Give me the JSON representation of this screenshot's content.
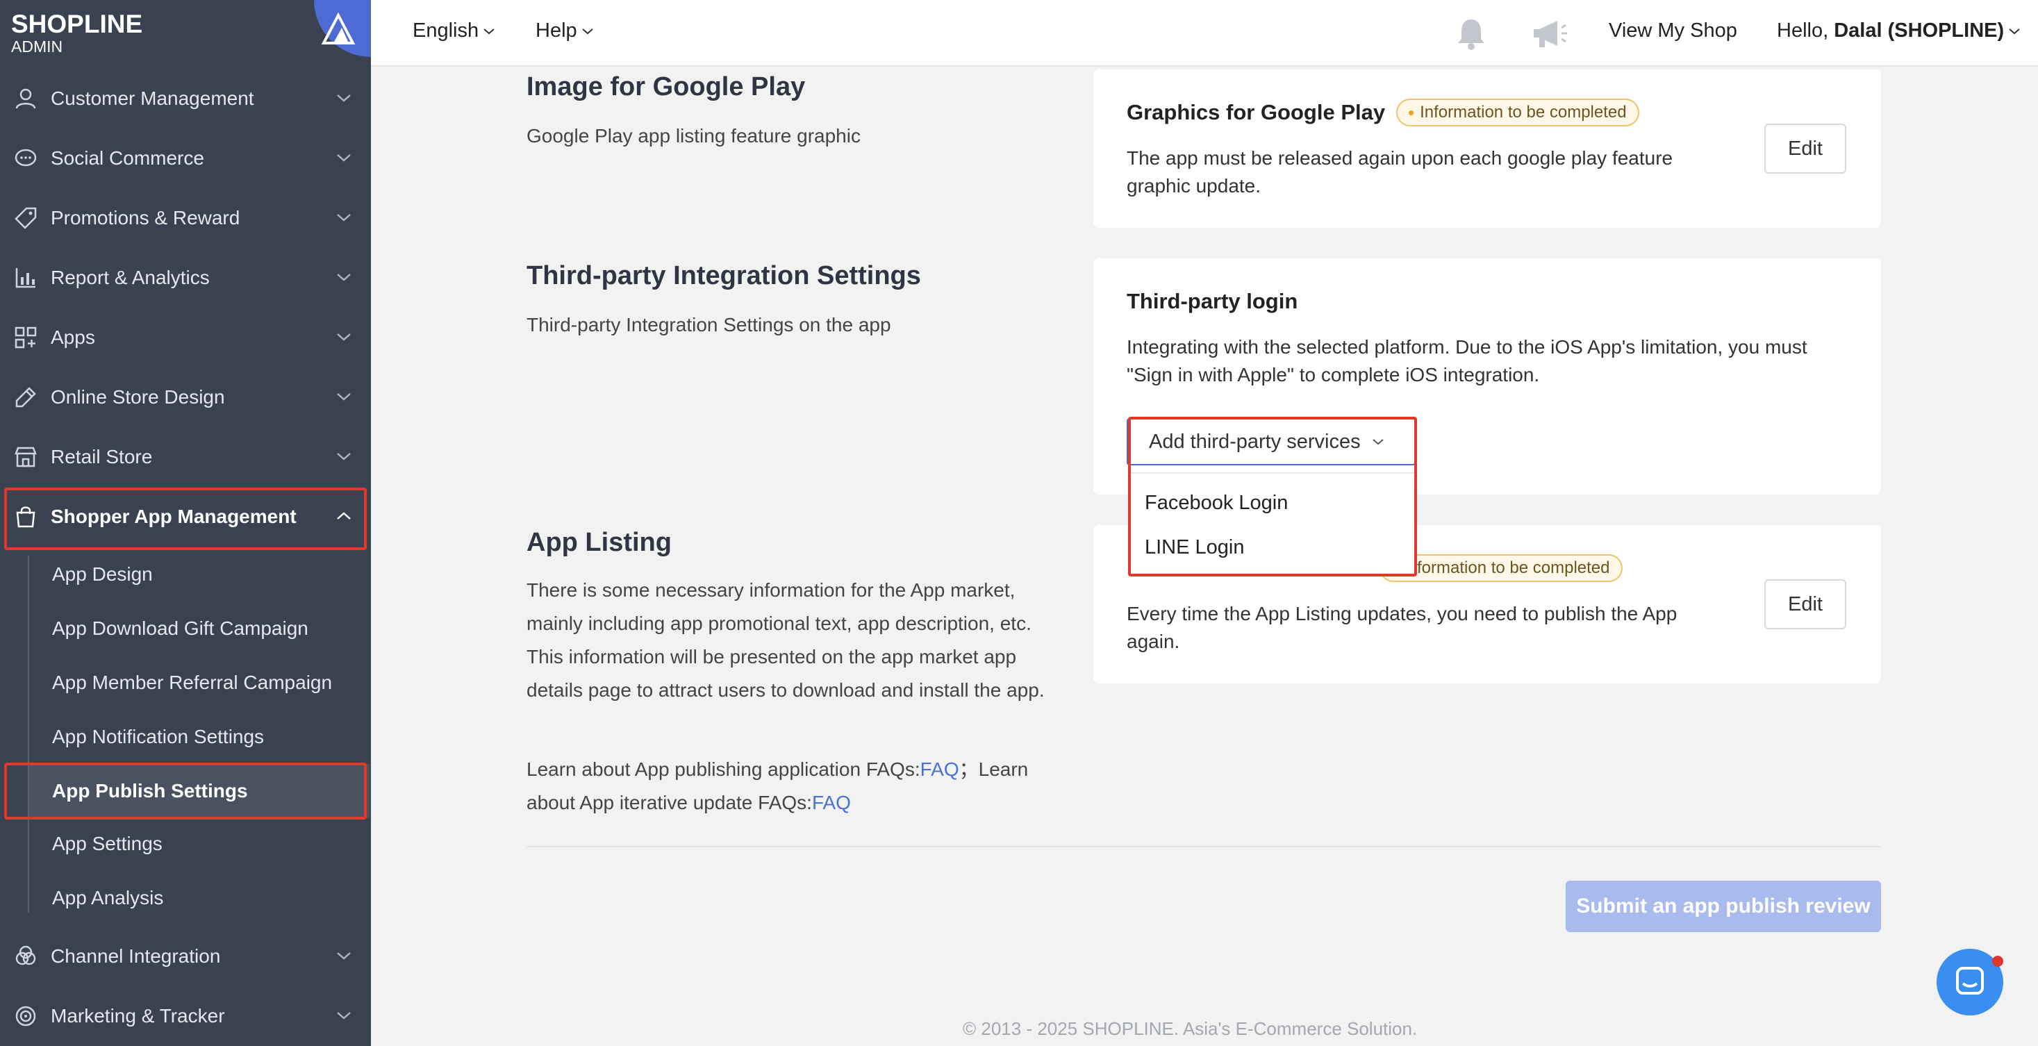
{
  "logo": {
    "brand": "SHOPLINE",
    "sub": "ADMIN"
  },
  "sidebar": {
    "items": [
      {
        "label": "Customer Management",
        "icon": "user-icon"
      },
      {
        "label": "Social Commerce",
        "icon": "chat-bubble-icon"
      },
      {
        "label": "Promotions & Reward",
        "icon": "tag-icon"
      },
      {
        "label": "Report & Analytics",
        "icon": "bar-chart-icon"
      },
      {
        "label": "Apps",
        "icon": "grid-icon"
      },
      {
        "label": "Online Store Design",
        "icon": "paint-icon"
      },
      {
        "label": "Retail Store",
        "icon": "store-icon"
      },
      {
        "label": "Shopper App Management",
        "icon": "shopping-bag-icon",
        "expanded": true
      },
      {
        "label": "Channel Integration",
        "icon": "channel-icon"
      },
      {
        "label": "Marketing & Tracker",
        "icon": "target-icon"
      }
    ],
    "sub_items": [
      {
        "label": "App Design"
      },
      {
        "label": "App Download Gift Campaign"
      },
      {
        "label": "App Member Referral Campaign"
      },
      {
        "label": "App Notification Settings"
      },
      {
        "label": "App Publish Settings",
        "active": true
      },
      {
        "label": "App Settings"
      },
      {
        "label": "App Analysis"
      }
    ]
  },
  "header": {
    "language": "English",
    "help": "Help",
    "view_shop": "View My Shop",
    "greeting": "Hello, ",
    "user": "Dalal (SHOPLINE)"
  },
  "sections": {
    "google_play": {
      "title": "Image for Google Play",
      "desc": "Google Play app listing feature graphic",
      "card_title": "Graphics for Google Play",
      "badge": "Information to be completed",
      "card_text": "The app must be released again upon each google play feature graphic update.",
      "edit": "Edit"
    },
    "third_party": {
      "title": "Third-party Integration Settings",
      "desc": "Third-party Integration Settings on the app",
      "card_title": "Third-party login",
      "card_text": "Integrating with the selected platform. Due to the iOS App's limitation, you must \"Sign in with Apple\" to complete iOS integration.",
      "add_button": "Add third-party services",
      "options": [
        "Facebook Login",
        "LINE Login"
      ]
    },
    "app_listing": {
      "title": "App Listing",
      "desc": "There is some necessary information for the App market, mainly including app promotional text, app description, etc. This information will be presented on the app market app details page to attract users to download and install the app.",
      "faq_line_1": "Learn about App publishing application FAQs:",
      "faq_link_1": "FAQ",
      "faq_line_2": "；Learn about App iterative update FAQs:",
      "faq_link_2": "FAQ",
      "badge": "Information to be completed",
      "card_text": "Every time the App Listing updates, you need to publish the App again.",
      "edit": "Edit"
    }
  },
  "submit": "Submit an app publish review",
  "footer": "© 2013 - 2025  SHOPLINE. Asia's E-Commerce Solution.",
  "colors": {
    "sidebar": "#3a4151",
    "accent": "#4d6bd3",
    "highlight": "#e0392b",
    "link": "#4a72d6"
  }
}
